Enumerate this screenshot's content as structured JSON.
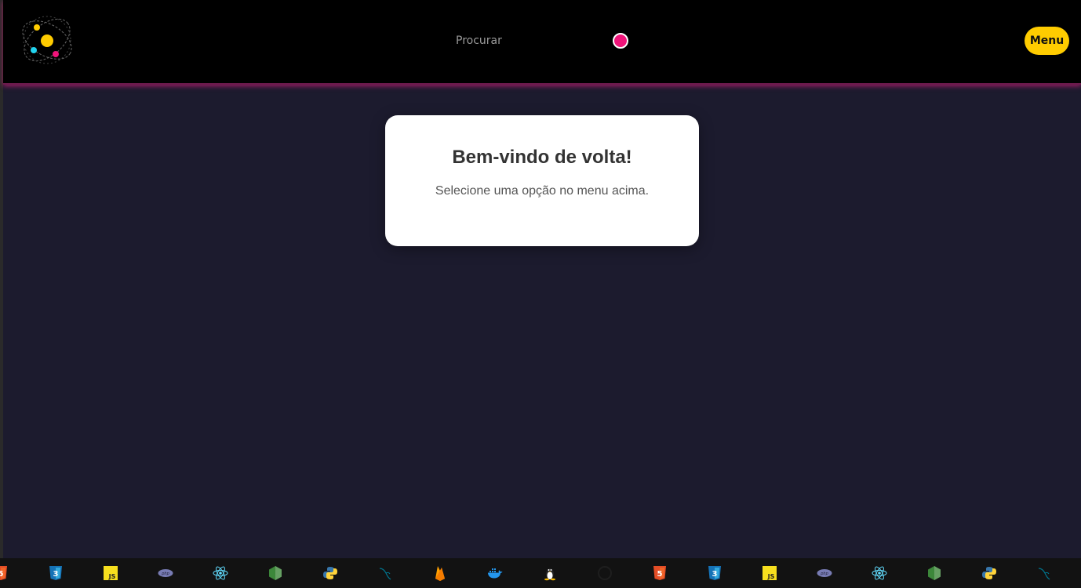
{
  "header": {
    "search_label": "Procurar",
    "menu_label": "Menu"
  },
  "welcome": {
    "title": "Bem-vindo de volta!",
    "message": "Selecione uma opção no menu acima."
  },
  "tech_bar": {
    "icons": [
      "html5-icon",
      "css3-icon",
      "javascript-icon",
      "php-icon",
      "react-icon",
      "nodejs-icon",
      "python-icon",
      "mysql-icon",
      "firebase-icon",
      "docker-icon",
      "linux-icon",
      "github-icon",
      "html5-icon",
      "css3-icon",
      "javascript-icon",
      "php-icon",
      "react-icon",
      "nodejs-icon",
      "python-icon",
      "mysql-icon"
    ]
  },
  "colors": {
    "header_bg": "#000000",
    "page_bg": "#1c1b2e",
    "accent_pink": "#f0147a",
    "accent_yellow": "#ffcc00",
    "card_bg": "#ffffff"
  }
}
